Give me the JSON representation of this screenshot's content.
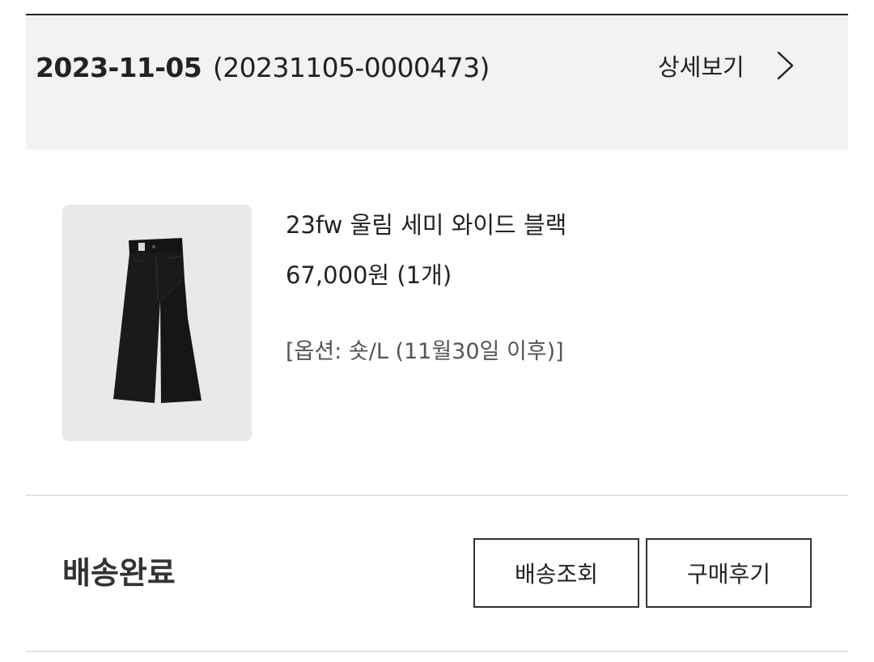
{
  "order": {
    "date": "2023-11-05",
    "number": "(20231105-0000473)",
    "detail_label": "상세보기",
    "detail_icon": "chevron-right-icon"
  },
  "product": {
    "image_icon": "wide-black-pants-image",
    "name": "23fw 울림 세미 와이드 블랙",
    "price": "67,000원 (1개)",
    "option": "[옵션: 숏/L (11월30일 이후)]"
  },
  "status": {
    "label": "배송완료"
  },
  "actions": {
    "tracking_label": "배송조회",
    "review_label": "구매후기"
  },
  "colors": {
    "header_bg": "#f2f2f2",
    "text": "#222222",
    "thumb_bg": "#e9e9e9",
    "divider": "#e3e3e3"
  }
}
